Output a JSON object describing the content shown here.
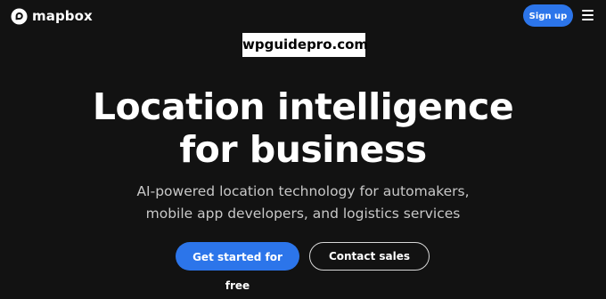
{
  "header": {
    "logo_text": "mapbox",
    "logo_icon": "mapbox-logo-icon",
    "signup_label": "Sign up",
    "menu_icon": "hamburger-menu-icon"
  },
  "watermark": {
    "text": "wpguidepro.com"
  },
  "hero": {
    "title_line1": "Location intelligence",
    "title_line2": "for business",
    "subtitle_line1": "AI-powered location technology for automakers,",
    "subtitle_line2": "mobile app developers, and logistics services",
    "primary_cta": "Get started for free",
    "secondary_cta": "Contact sales"
  },
  "colors": {
    "background": "#121212",
    "accent": "#2c75ea",
    "text": "#ffffff",
    "subtext": "#c8c8c8"
  }
}
